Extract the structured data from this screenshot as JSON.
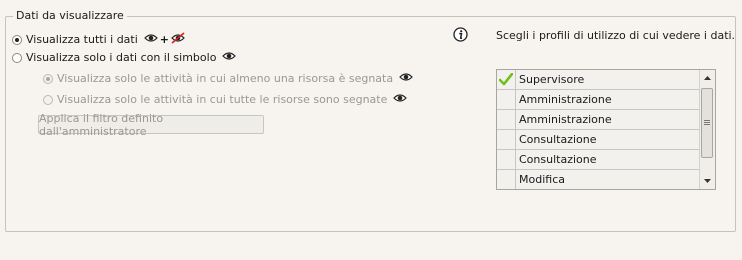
{
  "group": {
    "title": "Dati da visualizzare"
  },
  "options": {
    "show_all_label": "Visualizza tutti i dati",
    "show_all_plus": "+",
    "show_symbol_label": "Visualizza solo i dati con il simbolo",
    "sub_any_label": "Visualizza solo le attività in cui almeno una risorsa è segnata",
    "sub_all_label": "Visualizza solo le attività in cui tutte le risorse sono segnate",
    "apply_filter_button": "Applica il filtro definito dall'amministratore"
  },
  "profiles": {
    "label": "Scegli i profili di utilizzo di cui vedere i dati.",
    "items": [
      {
        "label": "Supervisore",
        "checked": true
      },
      {
        "label": "Amministrazione",
        "checked": false
      },
      {
        "label": "Amministrazione",
        "checked": false
      },
      {
        "label": "Consultazione",
        "checked": false
      },
      {
        "label": "Consultazione",
        "checked": false
      },
      {
        "label": "Modifica",
        "checked": false
      }
    ]
  },
  "icons": {
    "eye": "eye-icon",
    "eye_crossed": "eye-crossed-icon",
    "info": "info-icon",
    "check": "check-icon"
  },
  "colors": {
    "check": "#6cc21b",
    "cross": "#d9201c"
  }
}
